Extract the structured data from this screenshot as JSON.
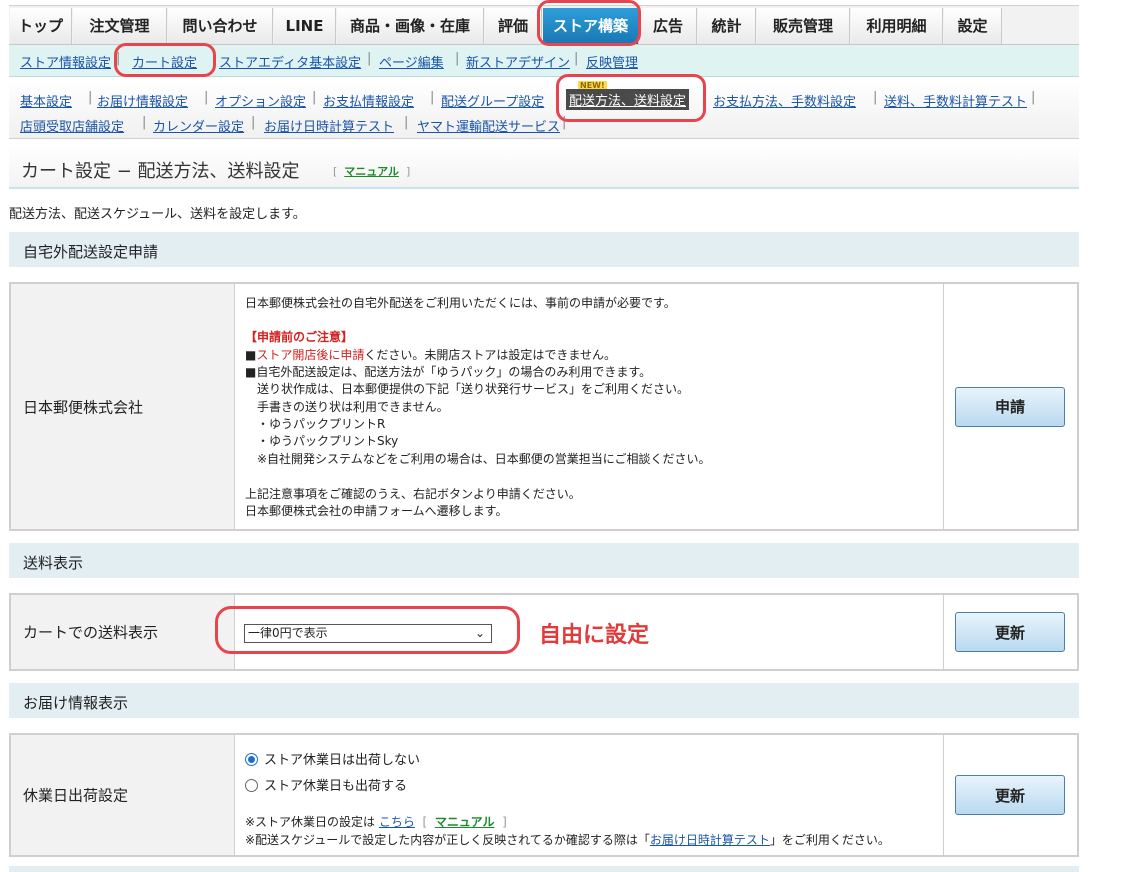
{
  "main_nav": {
    "tabs": [
      {
        "label": "トップ"
      },
      {
        "label": "注文管理"
      },
      {
        "label": "問い合わせ"
      },
      {
        "label": "LINE"
      },
      {
        "label": "商品・画像・在庫"
      },
      {
        "label": "評価"
      },
      {
        "label": "ストア構築",
        "active": true
      },
      {
        "label": "広告"
      },
      {
        "label": "統計"
      },
      {
        "label": "販売管理"
      },
      {
        "label": "利用明細"
      },
      {
        "label": "設定"
      }
    ]
  },
  "sub_nav": {
    "items": [
      {
        "label": "ストア情報設定"
      },
      {
        "label": "カート設定",
        "active": true
      },
      {
        "label": "ストアエディタ基本設定"
      },
      {
        "label": "ページ編集"
      },
      {
        "label": "新ストアデザイン"
      },
      {
        "label": "反映管理"
      }
    ]
  },
  "cart_nav": {
    "new_badge": "NEW!",
    "items": [
      {
        "label": "基本設定"
      },
      {
        "label": "お届け情報設定"
      },
      {
        "label": "オプション設定"
      },
      {
        "label": "お支払情報設定"
      },
      {
        "label": "配送グループ設定"
      },
      {
        "label": "配送方法、送料設定",
        "active": true
      },
      {
        "label": "お支払方法、手数料設定"
      },
      {
        "label": "送料、手数料計算テスト"
      },
      {
        "label": "店頭受取店舗設定"
      },
      {
        "label": "カレンダー設定"
      },
      {
        "label": "お届け日時計算テスト"
      },
      {
        "label": "ヤマト運輸配送サービス"
      }
    ]
  },
  "page": {
    "title": "カート設定 − 配送方法、送料設定",
    "manual_label": "マニュアル",
    "description": "配送方法、配送スケジュール、送料を設定します。"
  },
  "sections": {
    "home_delivery": {
      "heading": "自宅外配送設定申請",
      "label": "日本郵便株式会社",
      "lines": {
        "l1": "日本郵便株式会社の自宅外配送をご利用いただくには、事前の申請が必要です。",
        "notice_title": "【申請前のご注意】",
        "l2a": "■",
        "l2b": "ストア開店後に申請",
        "l2c": "ください。未開店ストアは設定はできません。",
        "l3": "■自宅外配送設定は、配送方法が「ゆうパック」の場合のみ利用できます。",
        "l4": "送り状作成は、日本郵便提供の下記「送り状発行サービス」をご利用ください。",
        "l5": "手書きの送り状は利用できません。",
        "l6": "・ゆうパックプリントR",
        "l7": "・ゆうパックプリントSky",
        "l8": "※自社開発システムなどをご利用の場合は、日本郵便の営業担当にご相談ください。",
        "l9": "上記注意事項をご確認のうえ、右記ボタンより申請ください。",
        "l10": "日本郵便株式会社の申請フォームへ遷移します。"
      },
      "button": "申請"
    },
    "shipping_display": {
      "heading": "送料表示",
      "label": "カートでの送料表示",
      "select_value": "一律0円で表示",
      "annotation": "自由に設定",
      "button": "更新"
    },
    "delivery_info": {
      "heading": "お届け情報表示",
      "label": "休業日出荷設定",
      "radio1": "ストア休業日は出荷しない",
      "radio2": "ストア休業日も出荷する",
      "note1_prefix": "※ストア休業日の設定は",
      "note1_link": "こちら",
      "note1_manual": "マニュアル",
      "note2_prefix": "※配送スケジュールで設定した内容が正しく反映されてるか確認する際は「",
      "note2_link": "お届け日時計算テスト",
      "note2_suffix": "」をご利用ください。",
      "button": "更新"
    }
  },
  "colors": {
    "active_tab": "#1877b5",
    "annotation_red": "#e8444e",
    "link_blue": "#1a55a8",
    "manual_green": "#1d8a2a"
  }
}
